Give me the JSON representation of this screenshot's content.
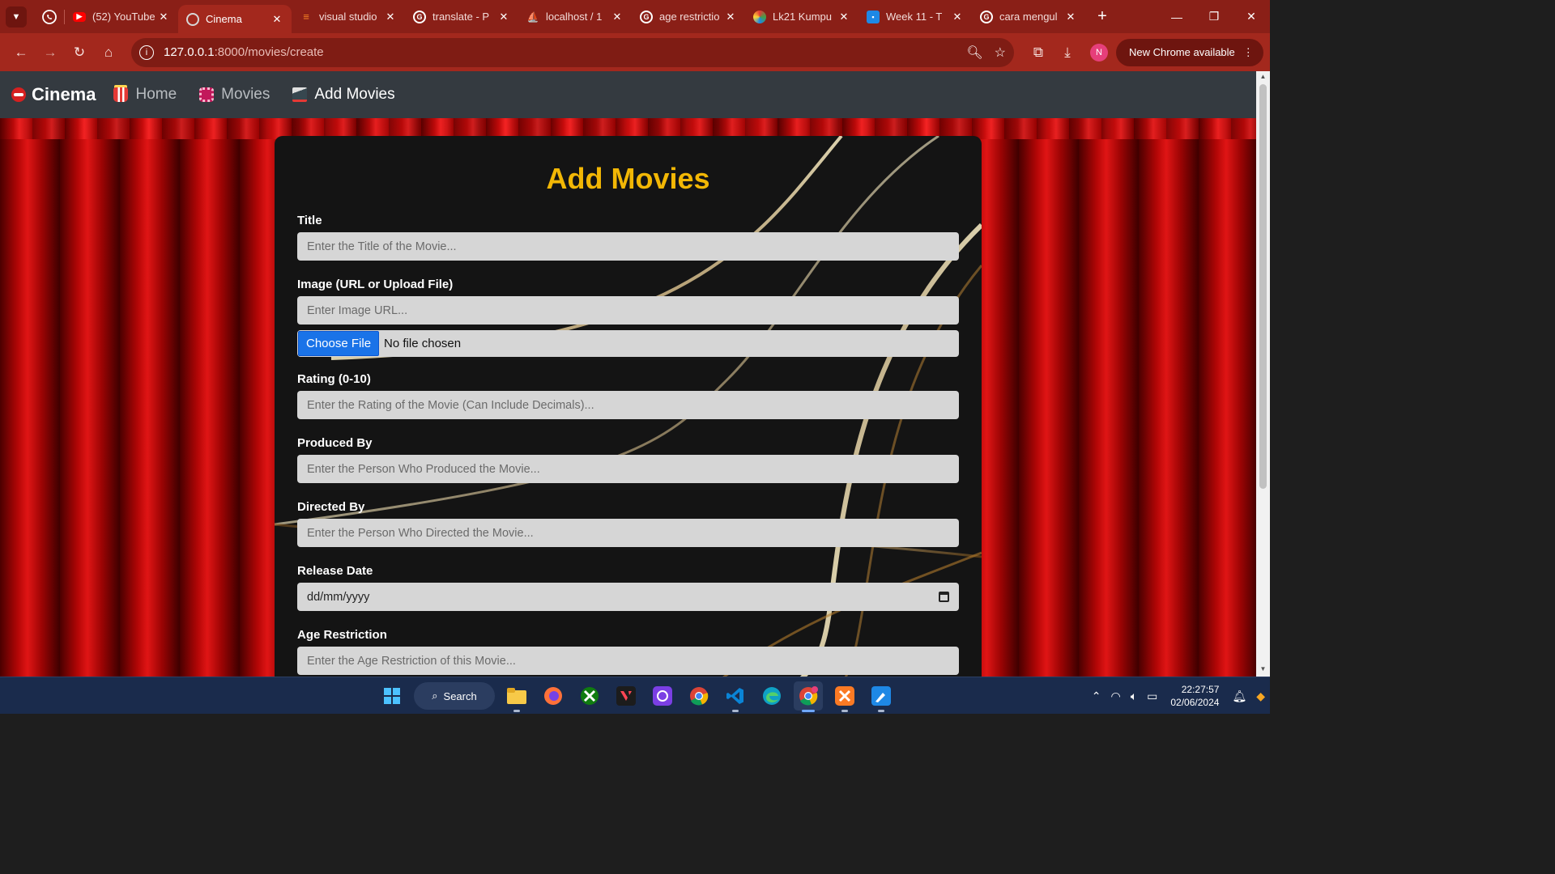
{
  "browser": {
    "tabs": [
      {
        "title": "(52) YouTube",
        "favicon": "youtube-icon",
        "color": "#ff0000",
        "active": false
      },
      {
        "title": "Cinema",
        "favicon": "globe-icon",
        "color": "#9aa0a6",
        "active": true
      },
      {
        "title": "visual studio",
        "favicon": "stackoverflow-icon",
        "color": "#f48024",
        "active": false
      },
      {
        "title": "translate - P",
        "favicon": "google-icon",
        "color": "#ffffff",
        "active": false
      },
      {
        "title": "localhost / 1",
        "favicon": "phpmyadmin-icon",
        "color": "#f89c0e",
        "active": false
      },
      {
        "title": "age restrictio",
        "favicon": "google-icon",
        "color": "#ffffff",
        "active": false
      },
      {
        "title": "Lk21 Kumpu",
        "favicon": "lk21-icon",
        "color": "#e53935",
        "active": false
      },
      {
        "title": "Week 11 - T",
        "favicon": "classroom-icon",
        "color": "#1e88e5",
        "active": false
      },
      {
        "title": "cara mengul",
        "favicon": "google-icon",
        "color": "#ffffff",
        "active": false
      }
    ],
    "url_host": "127.0.0.1",
    "url_path": ":8000/movies/create",
    "profile_initial": "N",
    "update_label": "New Chrome available",
    "accent": "#a3281d"
  },
  "nav": {
    "brand": "Cinema",
    "links": [
      {
        "label": "Home",
        "icon": "popcorn-icon"
      },
      {
        "label": "Movies",
        "icon": "film-icon"
      },
      {
        "label": "Add Movies",
        "icon": "clapperboard-icon"
      }
    ]
  },
  "form": {
    "heading": "Add Movies",
    "heading_color": "#f2b705",
    "title_label": "Title",
    "title_placeholder": "Enter the Title of the Movie...",
    "image_label": "Image (URL or Upload File)",
    "image_placeholder": "Enter Image URL...",
    "file_button": "Choose File",
    "file_status": "No file chosen",
    "rating_label": "Rating (0-10)",
    "rating_placeholder": "Enter the Rating of the Movie (Can Include Decimals)...",
    "produced_label": "Produced By",
    "produced_placeholder": "Enter the Person Who Produced the Movie...",
    "directed_label": "Directed By",
    "directed_placeholder": "Enter the Person Who Directed the Movie...",
    "release_label": "Release Date",
    "release_placeholder": "dd/mm/yyyy",
    "age_label": "Age Restriction",
    "age_placeholder": "Enter the Age Restriction of this Movie..."
  },
  "taskbar": {
    "search_label": "Search",
    "time": "22:27:57",
    "date": "02/06/2024",
    "apps": [
      "windows-start-icon",
      "file-explorer-icon",
      "firefox-icon",
      "xbox-icon",
      "valorant-icon",
      "photo-app-icon",
      "chrome-icon",
      "vscode-icon",
      "edge-icon",
      "chrome-profile-icon",
      "xampp-icon",
      "paint-icon"
    ]
  }
}
